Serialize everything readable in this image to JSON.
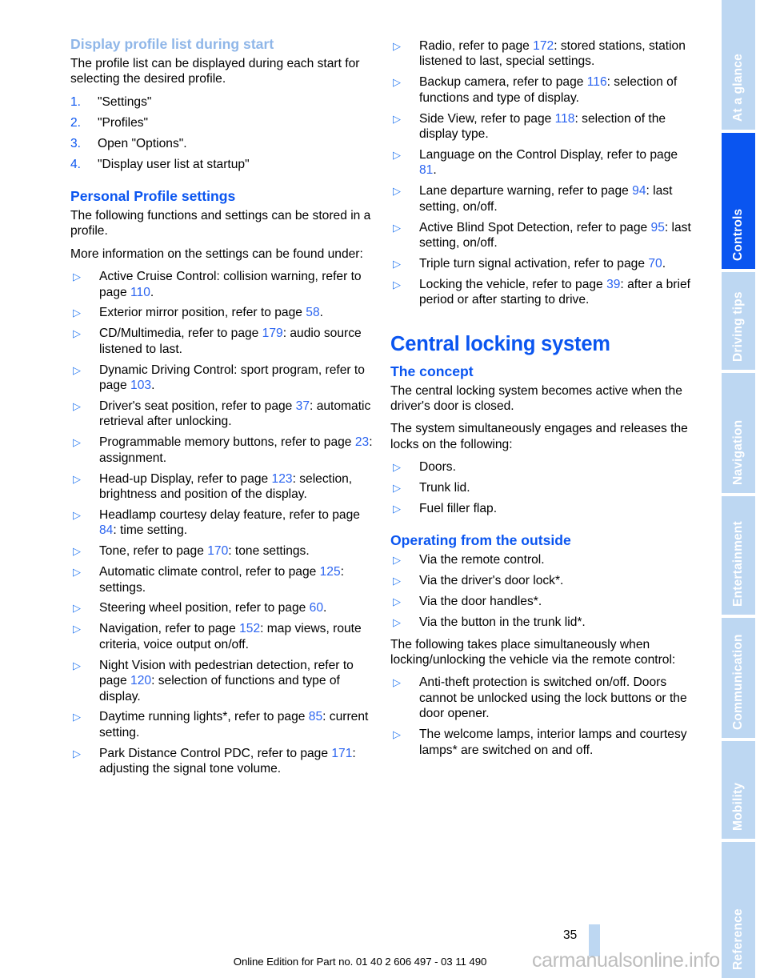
{
  "document": {
    "page_number": "35",
    "footer": "Online Edition for Part no. 01 40 2 606 497 - 03 11 490",
    "watermark": "carmanualsonline.info"
  },
  "colors": {
    "accent_blue": "#0a55f0",
    "faded_blue": "#8fb6e8",
    "tab_blue": "#bdd7f2",
    "link_blue": "#2b64f0"
  },
  "sidebar": {
    "tabs": [
      {
        "label": "At a glance",
        "active": false
      },
      {
        "label": "Controls",
        "active": true
      },
      {
        "label": "Driving tips",
        "active": false
      },
      {
        "label": "Navigation",
        "active": false
      },
      {
        "label": "Entertainment",
        "active": false
      },
      {
        "label": "Communication",
        "active": false
      },
      {
        "label": "Mobility",
        "active": false
      },
      {
        "label": "Reference",
        "active": false
      }
    ]
  },
  "left_column": {
    "heading_display_profile": "Display profile list during start",
    "intro_paragraph": "The profile list can be displayed during each start for selecting the desired profile.",
    "steps": [
      {
        "num": "1.",
        "text": "\"Settings\""
      },
      {
        "num": "2.",
        "text": "\"Profiles\""
      },
      {
        "num": "3.",
        "text": "Open \"Options\"."
      },
      {
        "num": "4.",
        "text": "\"Display user list at startup\""
      }
    ],
    "heading_personal_profile": "Personal Profile settings",
    "para_stored": "The following functions and settings can be stored in a profile.",
    "para_more_info": "More information on the settings can be found under:",
    "bullets": [
      {
        "pre": "Active Cruise Control: collision warning, refer to page ",
        "page": "110",
        "post": "."
      },
      {
        "pre": "Exterior mirror position, refer to page ",
        "page": "58",
        "post": "."
      },
      {
        "pre": "CD/Multimedia, refer to page ",
        "page": "179",
        "post": ": audio source listened to last."
      },
      {
        "pre": "Dynamic Driving Control: sport program, refer to page ",
        "page": "103",
        "post": "."
      },
      {
        "pre": "Driver's seat position, refer to page ",
        "page": "37",
        "post": ": automatic retrieval after unlocking."
      },
      {
        "pre": "Programmable memory buttons, refer to page ",
        "page": "23",
        "post": ": assignment."
      },
      {
        "pre": "Head-up Display, refer to page ",
        "page": "123",
        "post": ": selection, brightness and position of the display."
      },
      {
        "pre": "Headlamp courtesy delay feature, refer to page ",
        "page": "84",
        "post": ": time setting."
      },
      {
        "pre": "Tone, refer to page ",
        "page": "170",
        "post": ": tone settings."
      },
      {
        "pre": "Automatic climate control, refer to page ",
        "page": "125",
        "post": ": settings."
      },
      {
        "pre": "Steering wheel position, refer to page ",
        "page": "60",
        "post": "."
      },
      {
        "pre": "Navigation, refer to page ",
        "page": "152",
        "post": ": map views, route criteria, voice output on/off."
      },
      {
        "pre": "Night Vision with pedestrian detection, refer to page ",
        "page": "120",
        "post": ": selection of functions and type of display."
      },
      {
        "pre": "Daytime running lights*, refer to page ",
        "page": "85",
        "post": ": current setting."
      },
      {
        "pre": "Park Distance Control PDC, refer to page ",
        "page": "171",
        "post": ": adjusting the signal tone volume."
      }
    ]
  },
  "right_column": {
    "bullets_continued": [
      {
        "pre": "Radio, refer to page ",
        "page": "172",
        "post": ": stored stations, station listened to last, special settings."
      },
      {
        "pre": "Backup camera, refer to page ",
        "page": "116",
        "post": ": selection of functions and type of display."
      },
      {
        "pre": "Side View, refer to page ",
        "page": "118",
        "post": ": selection of the display type."
      },
      {
        "pre": "Language on the Control Display, refer to page ",
        "page": "81",
        "post": "."
      },
      {
        "pre": "Lane departure warning, refer to page ",
        "page": "94",
        "post": ": last setting, on/off."
      },
      {
        "pre": "Active Blind Spot Detection, refer to page ",
        "page": "95",
        "post": ": last setting, on/off."
      },
      {
        "pre": "Triple turn signal activation, refer to page ",
        "page": "70",
        "post": "."
      },
      {
        "pre": "Locking the vehicle, refer to page ",
        "page": "39",
        "post": ": after a brief period or after starting to drive."
      }
    ],
    "chapter_title": "Central locking system",
    "heading_concept": "The concept",
    "para_concept_1": "The central locking system becomes active when the driver's door is closed.",
    "para_concept_2": "The system simultaneously engages and releases the locks on the following:",
    "concept_bullets": [
      {
        "pre": "Doors.",
        "page": "",
        "post": ""
      },
      {
        "pre": "Trunk lid.",
        "page": "",
        "post": ""
      },
      {
        "pre": "Fuel filler flap.",
        "page": "",
        "post": ""
      }
    ],
    "heading_outside": "Operating from the outside",
    "outside_bullets": [
      {
        "pre": "Via the remote control.",
        "page": "",
        "post": ""
      },
      {
        "pre": "Via the driver's door lock*.",
        "page": "",
        "post": ""
      },
      {
        "pre": "Via the door handles*.",
        "page": "",
        "post": ""
      },
      {
        "pre": "Via the button in the trunk lid*.",
        "page": "",
        "post": ""
      }
    ],
    "para_simultaneous": "The following takes place simultaneously when locking/unlocking the vehicle via the remote control:",
    "simultaneous_bullets": [
      {
        "pre": "Anti-theft protection is switched on/off. Doors cannot be unlocked using the lock buttons or the door opener.",
        "page": "",
        "post": ""
      },
      {
        "pre": "The welcome lamps, interior lamps and courtesy lamps* are switched on and off.",
        "page": "",
        "post": ""
      }
    ]
  },
  "icons": {
    "bullet": "triangle-right-icon"
  }
}
